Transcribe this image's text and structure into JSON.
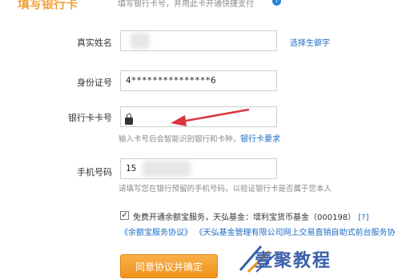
{
  "header": {
    "title": "填写银行卡",
    "hint": "填写银行卡号，并用此卡开通快捷支付"
  },
  "form": {
    "name": {
      "label": "真实姓名",
      "value": "",
      "link": "选择生僻字"
    },
    "id": {
      "label": "身份证号",
      "value": "4***************6"
    },
    "card": {
      "label": "银行卡卡号",
      "value": "",
      "hint": "输入卡号后会智能识别银行和卡种，",
      "hint_link": "银行卡要求"
    },
    "phone": {
      "label": "手机号码",
      "value": "15",
      "hint": "请填写您在银行预留的手机号码，以验证银行卡是否属于您本人"
    }
  },
  "agreement": {
    "checked": true,
    "text": "免费开通余额宝服务，天弘基金：增利宝货币基金（000198）",
    "help": "[?]",
    "link1": "《余额宝服务协议》",
    "link2": "《天弘基金管理有限公司网上交易直销自助式前台服务协"
  },
  "submit_label": "同意协议并确定",
  "watermark": "壹聚教程",
  "colors": {
    "accent": "#f0921c",
    "link": "#1d6bc4",
    "arrow": "#d9363e"
  }
}
